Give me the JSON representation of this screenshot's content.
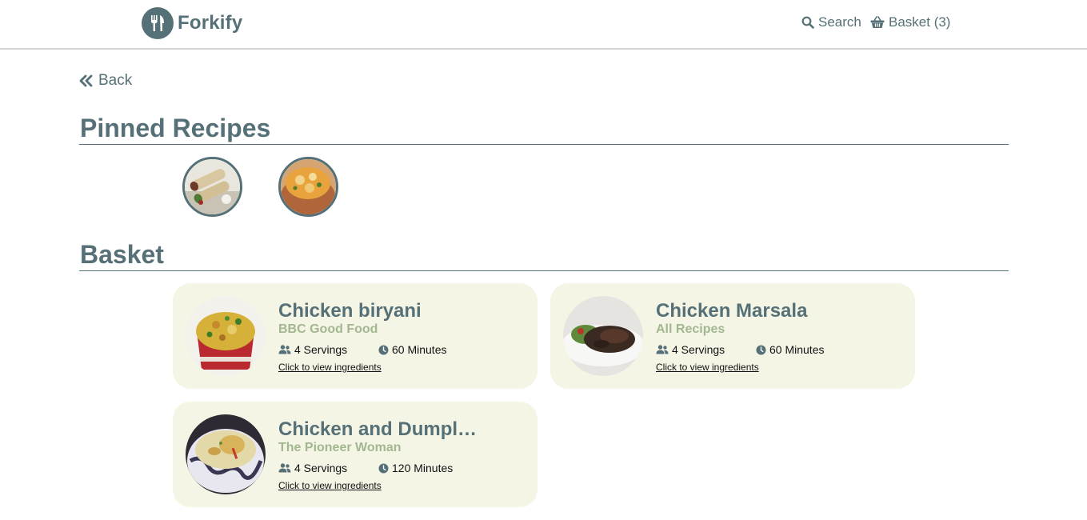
{
  "header": {
    "logo_text": "Forkify",
    "search_label": "Search",
    "basket_label": "Basket (3)"
  },
  "back_label": "Back",
  "pinned": {
    "title": "Pinned Recipes"
  },
  "basket": {
    "title": "Basket",
    "items": [
      {
        "title": "Chicken biryani",
        "source": "BBC Good Food",
        "servings": "4 Servings",
        "time": "60 Minutes",
        "link": "Click to view ingredients"
      },
      {
        "title": "Chicken Marsala",
        "source": "All Recipes",
        "servings": "4 Servings",
        "time": "60 Minutes",
        "link": "Click to view ingredients"
      },
      {
        "title": "Chicken and Dumpl…",
        "source": "The Pioneer Woman",
        "servings": "4 Servings",
        "time": "120 Minutes",
        "link": "Click to view ingredients"
      }
    ]
  },
  "colors": {
    "primary": "#557076",
    "card_bg": "#f5f5e6",
    "source": "#a2b790"
  }
}
